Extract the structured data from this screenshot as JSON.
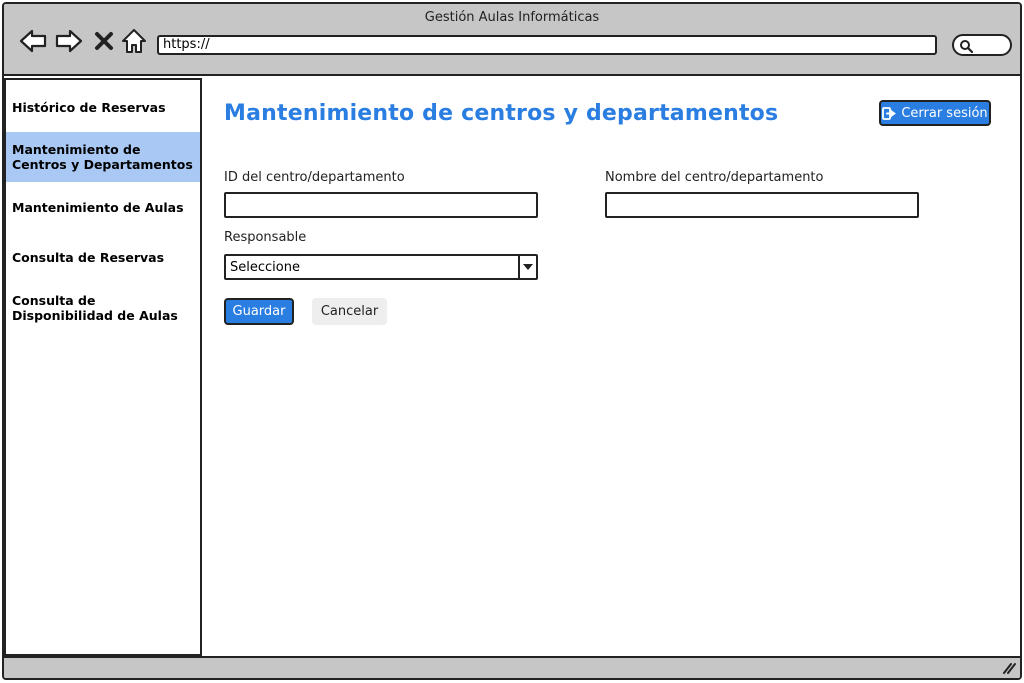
{
  "window": {
    "title": "Gestión Aulas Informáticas"
  },
  "browser": {
    "url": "https://",
    "nav_icons": [
      "back-arrow-icon",
      "forward-arrow-icon",
      "close-icon",
      "home-icon"
    ],
    "search_icon": "search-icon"
  },
  "sidebar": {
    "items": [
      {
        "label": "Histórico de Reservas",
        "active": false
      },
      {
        "label": "Mantenimiento de Centros y Departamentos",
        "active": true
      },
      {
        "label": "Mantenimiento de Aulas",
        "active": false
      },
      {
        "label": "Consulta de Reservas",
        "active": false
      },
      {
        "label": "Consulta de Disponibilidad de Aulas",
        "active": false
      }
    ]
  },
  "main": {
    "title": "Mantenimiento de centros y departamentos",
    "logout_label": "Cerrar sesión",
    "logout_icon": "logout-icon",
    "fields": {
      "id_label": "ID del centro/departamento",
      "id_value": "",
      "name_label": "Nombre del centro/departamento",
      "name_value": "",
      "responsable_label": "Responsable",
      "responsable_value": "Seleccione"
    },
    "save_label": "Guardar",
    "cancel_label": "Cancelar"
  },
  "colors": {
    "accent": "#2a7de1",
    "sidebar_active": "#a9c9f4",
    "chrome": "#c6c6c6"
  }
}
